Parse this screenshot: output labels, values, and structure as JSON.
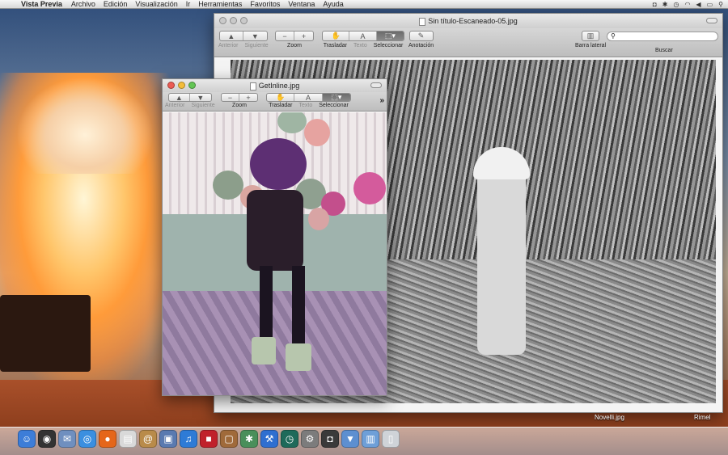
{
  "menubar": {
    "apple": "",
    "app_name": "Vista Previa",
    "items": [
      "Archivo",
      "Edición",
      "Visualización",
      "Ir",
      "Herramientas",
      "Favoritos",
      "Ventana",
      "Ayuda"
    ]
  },
  "window_back": {
    "title": "Sin título-Escaneado-05.jpg",
    "toolbar": {
      "anterior": "Anterior",
      "siguiente": "Siguiente",
      "zoom": "Zoom",
      "zoom_out_glyph": "−",
      "zoom_in_glyph": "+",
      "trasladar": "Trasladar",
      "texto": "Texto",
      "seleccionar": "Seleccionar",
      "anotacion": "Anotación",
      "barra_lateral": "Barra lateral",
      "buscar": "Buscar"
    }
  },
  "window_front": {
    "title": "GetInline.jpg",
    "toolbar": {
      "anterior": "Anterior",
      "siguiente": "Siguiente",
      "zoom": "Zoom",
      "zoom_out_glyph": "−",
      "zoom_in_glyph": "+",
      "trasladar": "Trasladar",
      "texto": "Texto",
      "seleccionar": "Seleccionar",
      "overflow": "»"
    }
  },
  "dock": {
    "labels": [
      "Novelli.jpg",
      "Rimel"
    ],
    "icons": [
      {
        "name": "finder-icon",
        "color": "#3d7dd8",
        "glyph": "☺"
      },
      {
        "name": "dashboard-icon",
        "color": "#333333",
        "glyph": "◉"
      },
      {
        "name": "mail-icon",
        "color": "#6f8fbf",
        "glyph": "✉"
      },
      {
        "name": "safari-icon",
        "color": "#3b8fe0",
        "glyph": "◎"
      },
      {
        "name": "firefox-icon",
        "color": "#e5661a",
        "glyph": "●"
      },
      {
        "name": "ical-icon",
        "color": "#d9d9d9",
        "glyph": "▤"
      },
      {
        "name": "address-book-icon",
        "color": "#b98b4a",
        "glyph": "@"
      },
      {
        "name": "iphoto-icon",
        "color": "#5a7ab0",
        "glyph": "▣"
      },
      {
        "name": "itunes-icon",
        "color": "#2e7bd6",
        "glyph": "♫"
      },
      {
        "name": "photo-booth-icon",
        "color": "#c0212b",
        "glyph": "■"
      },
      {
        "name": "image-capture-icon",
        "color": "#a06a3a",
        "glyph": "▢"
      },
      {
        "name": "preview-icon",
        "color": "#4a8f5a",
        "glyph": "✱"
      },
      {
        "name": "xcode-icon",
        "color": "#2f6fd0",
        "glyph": "⚒"
      },
      {
        "name": "time-machine-icon",
        "color": "#1e6a5a",
        "glyph": "◷"
      },
      {
        "name": "system-prefs-icon",
        "color": "#7c7c7c",
        "glyph": "⚙"
      },
      {
        "name": "camera-icon",
        "color": "#3a3a3a",
        "glyph": "◘"
      },
      {
        "name": "downloads-stack-icon",
        "color": "#5d8fd0",
        "glyph": "▼"
      },
      {
        "name": "documents-stack-icon",
        "color": "#6e9fd8",
        "glyph": "▥"
      },
      {
        "name": "trash-icon",
        "color": "#cfd3d8",
        "glyph": "▯"
      }
    ]
  }
}
